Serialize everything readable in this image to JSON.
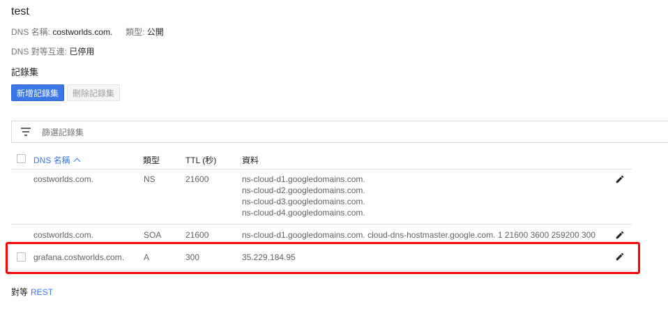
{
  "zone": {
    "title": "test",
    "dns_name_label": "DNS 名稱:",
    "dns_name_value": "costworlds.com.",
    "type_label": "類型:",
    "type_value": "公開",
    "peering_label": "DNS 對等互連:",
    "peering_value": "已停用"
  },
  "records": {
    "section_title": "記錄集",
    "add_button": "新增記錄集",
    "delete_button": "刪除記錄集",
    "filter_placeholder": "篩選記錄集",
    "columns": {
      "name": "DNS 名稱",
      "type": "類型",
      "ttl": "TTL (秒)",
      "data": "資料"
    },
    "rows": [
      {
        "name": "costworlds.com.",
        "type": "NS",
        "ttl": "21600",
        "data": [
          "ns-cloud-d1.googledomains.com.",
          "ns-cloud-d2.googledomains.com.",
          "ns-cloud-d3.googledomains.com.",
          "ns-cloud-d4.googledomains.com."
        ]
      },
      {
        "name": "costworlds.com.",
        "type": "SOA",
        "ttl": "21600",
        "data": [
          "ns-cloud-d1.googledomains.com. cloud-dns-hostmaster.google.com. 1 21600 3600 259200 300"
        ]
      },
      {
        "name": "grafana.costworlds.com.",
        "type": "A",
        "ttl": "300",
        "data": [
          "35.229.184.95"
        ]
      }
    ]
  },
  "footer": {
    "label": "對等",
    "link": "REST"
  },
  "colors": {
    "accent": "#3b78e7",
    "highlight": "#ff0000"
  },
  "icons": {
    "filter": "filter-list-icon",
    "edit": "pencil-icon",
    "sort": "chevron-up-icon"
  }
}
